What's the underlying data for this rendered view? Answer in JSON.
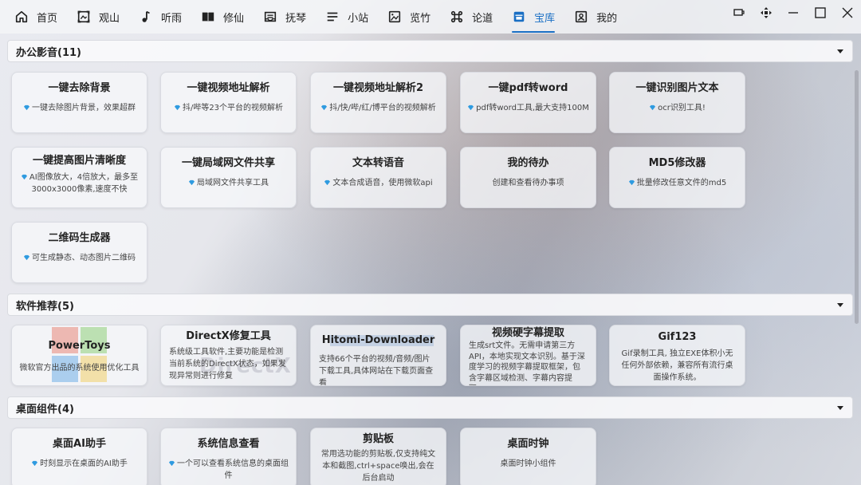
{
  "nav": {
    "items": [
      {
        "label": "首页",
        "icon": "home-icon"
      },
      {
        "label": "观山",
        "icon": "frame-icon"
      },
      {
        "label": "听雨",
        "icon": "music-note-icon"
      },
      {
        "label": "修仙",
        "icon": "book-icon"
      },
      {
        "label": "抚琴",
        "icon": "inbox-icon"
      },
      {
        "label": "小站",
        "icon": "list-icon"
      },
      {
        "label": "览竹",
        "icon": "image-icon"
      },
      {
        "label": "论道",
        "icon": "command-icon"
      },
      {
        "label": "宝库",
        "icon": "treasury-icon",
        "active": true
      },
      {
        "label": "我的",
        "icon": "profile-icon"
      }
    ],
    "active_color": "#1a6fc4"
  },
  "window": {
    "controls": [
      "keyboard-icon",
      "move-icon",
      "minimize-icon",
      "maximize-icon",
      "close-icon"
    ]
  },
  "sections": [
    {
      "title": "办公影音(11)",
      "cards": [
        {
          "title": "一键去除背景",
          "desc": "一键去除图片背景，效果超群"
        },
        {
          "title": "一键视频地址解析",
          "desc": "抖/哔等23个平台的视频解析"
        },
        {
          "title": "一键视频地址解析2",
          "desc": "抖/快/哔/红/博平台的视频解析"
        },
        {
          "title": "一键pdf转word",
          "desc": "pdf转word工具,最大支持100M"
        },
        {
          "title": "一键识别图片文本",
          "desc": "ocr识别工具!"
        },
        {
          "title": "一键提高图片清晰度",
          "desc": "AI图像放大，4倍放大，最多至3000x3000像素,速度不快"
        },
        {
          "title": "一键局域网文件共享",
          "desc": "局域网文件共享工具"
        },
        {
          "title": "文本转语音",
          "desc": "文本合成语音，使用微软api"
        },
        {
          "title": "我的待办",
          "desc": "创建和查看待办事项"
        },
        {
          "title": "MD5修改器",
          "desc": "批量修改任意文件的md5"
        },
        {
          "title": "二维码生成器",
          "desc": "可生成静态、动态图片二维码"
        }
      ]
    },
    {
      "title": "软件推荐(5)",
      "cards": [
        {
          "title": "PowerToys",
          "desc": "微软官方出品的系统使用优化工具"
        },
        {
          "title": "DirectX修复工具",
          "desc": "系统级工具软件,主要功能是检测当前系统的DirectX状态，如果发现异常则进行修复"
        },
        {
          "title": "Hitomi-Downloader",
          "desc": "支持66个平台的视频/音频/图片下载工具,具体网站在下载页面查看"
        },
        {
          "title": "视频硬字幕提取",
          "desc": "生成srt文件。无需申请第三方API，本地实现文本识别。基于深度学习的视频字幕提取框架，包含字幕区域检测、字幕内容提取。"
        },
        {
          "title": "Gif123",
          "desc": "Gif录制工具, 独立EXE体积小无任何外部依赖，兼容所有流行桌面操作系统。"
        }
      ]
    },
    {
      "title": "桌面组件(4)",
      "cards": [
        {
          "title": "桌面AI助手",
          "desc": "时刻显示在桌面的AI助手"
        },
        {
          "title": "系统信息查看",
          "desc": "一个可以查看系统信息的桌面组件"
        },
        {
          "title": "剪贴板",
          "desc": "常用选功能的剪贴板,仅支持纯文本和截图,ctrl+space唤出,会在后台启动"
        },
        {
          "title": "桌面时钟",
          "desc": "桌面时钟小组件"
        }
      ]
    }
  ],
  "logos": {
    "directx": "DirectX"
  },
  "colors": {
    "gem": "#2f9be0",
    "accent": "#1a6fc4"
  }
}
